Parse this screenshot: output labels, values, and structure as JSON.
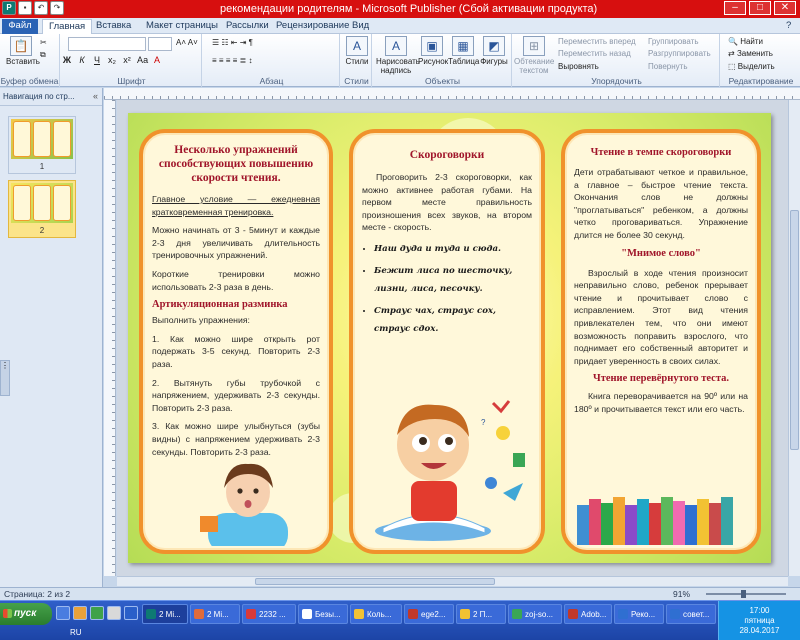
{
  "window": {
    "title": "рекомендации родителям - Microsoft Publisher (Сбой активации продукта)",
    "help": "?"
  },
  "tabs": [
    "Файл",
    "Главная",
    "Вставка",
    "Макет страницы",
    "Рассылки",
    "Рецензирование",
    "Вид"
  ],
  "ribbon": {
    "clipboard": {
      "paste": "Вставить",
      "label": "Буфер обмена"
    },
    "font": {
      "label": "Шрифт"
    },
    "paragraph": {
      "label": "Абзац"
    },
    "styles": {
      "btn": "Стили",
      "label": "Стили"
    },
    "objects": {
      "draw_text": "Нарисовать надпись",
      "picture": "Рисунок",
      "table": "Таблица",
      "shapes": "Фигуры",
      "label": "Объекты"
    },
    "wrap": "Обтекание текстом",
    "arrange": {
      "bring_forward": "Переместить вперед",
      "send_backward": "Переместить назад",
      "align": "Выровнять",
      "group": "Группировать",
      "ungroup": "Разгруппировать",
      "rotate": "Повернуть",
      "label": "Упорядочить"
    },
    "editing": {
      "find": "Найти",
      "replace": "Заменить",
      "select": "Выделить",
      "label": "Редактирование"
    }
  },
  "nav": {
    "title": "Навигация по стр...",
    "pages": [
      "1",
      "2"
    ]
  },
  "status": {
    "page": "Страница: 2 из 2",
    "zoom": "91%"
  },
  "document": {
    "col1": {
      "title": "Несколько упражнений способствующих повышению скорости чтения.",
      "p1": "Главное условие — ежедневная кратковременная тренировка.",
      "p2": "Можно начинать от 3 - 5минут и каждые 2-3 дня увеличивать длительность тренировочных упражнений.",
      "p3": "Короткие тренировки можно использовать 2-3 раза в день.",
      "sub": "Артикуляционная разминка",
      "p4": "Выполнить упражнения:",
      "ex1": "1. Как можно шире открыть рот подержать 3-5 секунд. Повторить 2-3 раза.",
      "ex2": "2. Вытянуть губы трубочкой с напряжением, удерживать 2-3 секунды. Повторить 2-3 раза.",
      "ex3": "3. Как можно шире улыбнуться (зубы видны) с напряжением удерживать 2-3 секунды. Повторить 2-3 раза."
    },
    "col2": {
      "title": "Скороговорки",
      "p1": "Проговорить 2-3 скороговорки, как можно активнее работая губами. На первом месте правильность произношения всех звуков, на втором месте - скорость.",
      "t1": "Наш дуда и туда и сюда.",
      "t2": "Бежит лиса по шесточку, лизни, лиса, песочку.",
      "t3": "Страус чах, страус сох, страус сдох."
    },
    "col3": {
      "title": "Чтение в темпе скороговорки",
      "p1": "Дети отрабатывают четкое и правильное, а главное – быстрое чтение текста. Окончания слов не должны \"проглатываться\" ребенком, а должны четко проговариваться. Упражнение длится не более 30 секунд.",
      "sub1": "\"Мнимое слово\"",
      "p2": "Взрослый в ходе чтения произносит неправильно слово, ребенок прерывает чтение и прочитывает слово с исправлением. Этот вид чтения привлекателен тем, что они имеют возможность поправить взрослого, что поднимает его собственный авторитет и придает уверенность в своих силах.",
      "sub2": "Чтение перевёрнутого теста.",
      "p3": "Книга переворачивается на 90º или на 180º и прочитывается текст или его часть."
    }
  },
  "taskbar": {
    "start": "пуск",
    "tasks": [
      "2 Mi...",
      "2 Mi...",
      "2232 ...",
      "Безы...",
      "Коль...",
      "ege2...",
      "2 П...",
      "zoj-so...",
      "Adob...",
      "Реко...",
      "совет..."
    ],
    "lang": "RU",
    "time": "17:00",
    "day": "пятница",
    "date": "28.04.2017"
  }
}
